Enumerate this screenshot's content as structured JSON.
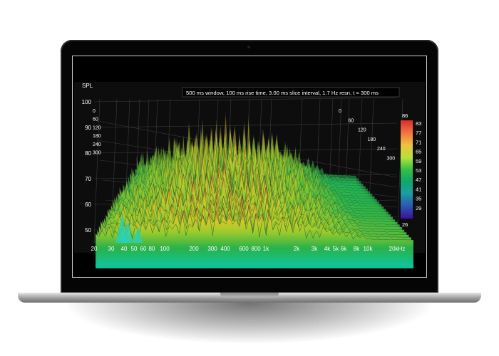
{
  "plot": {
    "y_axis_title": "SPL",
    "info_text": "500 ms window, 100 ms rise time, 3.00 ms slice interval, 1.7 Hz resn, t = 300 ms",
    "y_ticks": [
      "100",
      "90",
      "80",
      "70",
      "60",
      "50"
    ],
    "time_ticks_left": [
      "0",
      "60",
      "120",
      "180",
      "240",
      "300"
    ],
    "time_ticks_right": [
      "0",
      "60",
      "120",
      "180",
      "240",
      "300"
    ],
    "x_ticks": [
      "20",
      "30",
      "40",
      "50",
      "60",
      "80",
      "100",
      "200",
      "300",
      "400",
      "600",
      "800",
      "1k",
      "2k",
      "3k",
      "4k",
      "5k",
      "6k",
      "8k",
      "10k",
      "20kHz"
    ]
  },
  "colorbar": {
    "max_label": "86",
    "min_label": "26",
    "labels": [
      "83",
      "77",
      "71",
      "65",
      "59",
      "53",
      "47",
      "41",
      "35",
      "29"
    ],
    "colors": [
      "#d73027",
      "#f46d43",
      "#fdae61",
      "#d9ef8b",
      "#a6d96a",
      "#66bd63",
      "#1a9850",
      "#17a88a",
      "#2c7fb8",
      "#253494",
      "#3b0f9e"
    ]
  }
}
